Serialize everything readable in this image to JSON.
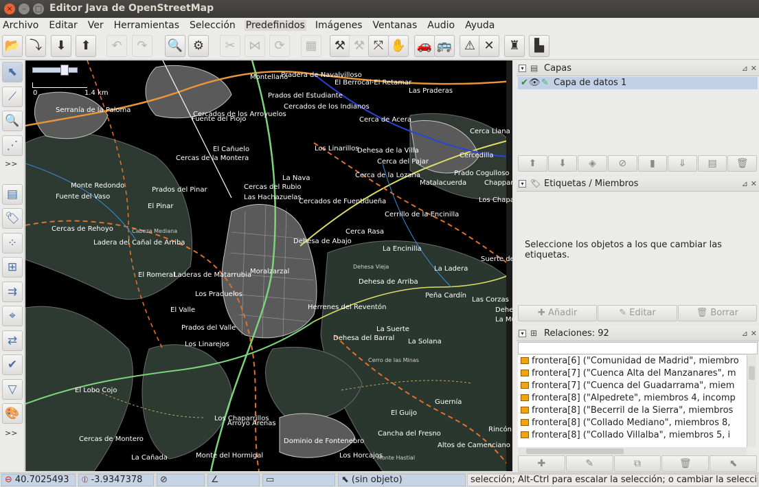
{
  "window": {
    "title": "Editor Java de OpenStreetMap"
  },
  "menu": [
    "Archivo",
    "Editar",
    "Ver",
    "Herramientas",
    "Selección",
    "Predefinidos",
    "Imágenes",
    "Ventanas",
    "Audio",
    "Ayuda"
  ],
  "map": {
    "scale_label": "1.4 km",
    "scale_zero": "0",
    "places": [
      {
        "t": "Montellano"
      },
      {
        "t": "Pradera de Navalvilloso"
      },
      {
        "t": "El Berrocal-El Retamar"
      },
      {
        "t": "Las Praderas"
      },
      {
        "t": "Prados del Estudiante"
      },
      {
        "t": "Cercados de los Indianos"
      },
      {
        "t": "Serranía de la Paloma"
      },
      {
        "t": "Cercados de los Arroyuelos"
      },
      {
        "t": "Fuente del Piojo"
      },
      {
        "t": "Cerca de Acera"
      },
      {
        "t": "Cerca Llana"
      },
      {
        "t": "El Cañuelo"
      },
      {
        "t": "Cercas de la Montera"
      },
      {
        "t": "Los Linarillos"
      },
      {
        "t": "Dehesa de la Villa"
      },
      {
        "t": "Cercedilla"
      },
      {
        "t": "Cerca del Pajar"
      },
      {
        "t": "La Nava"
      },
      {
        "t": "Cerca de la Lozana"
      },
      {
        "t": "Prado Cogulloso"
      },
      {
        "t": "Matalacuerda"
      },
      {
        "t": "Chapparal"
      },
      {
        "t": "Monte Redondo"
      },
      {
        "t": "Cercas del Rubio"
      },
      {
        "t": "Prados del Pinar"
      },
      {
        "t": "Fuente del Vaso"
      },
      {
        "t": "Las Hachazuelas"
      },
      {
        "t": "Los Chapa"
      },
      {
        "t": "El Pinar"
      },
      {
        "t": "Cercados de Fuentidueña"
      },
      {
        "t": "Cerrillo de la Encinilla"
      },
      {
        "t": "Cercas de Rehoyo"
      },
      {
        "t": "Cabeza Mediana"
      },
      {
        "t": "Cerca Rasa"
      },
      {
        "t": "Ladera del Cañal de Arriba"
      },
      {
        "t": "Dehesa de Abajo"
      },
      {
        "t": "La Encinilla"
      },
      {
        "t": "Suerte de"
      },
      {
        "t": "Dehesa Vieja"
      },
      {
        "t": "Moralzarzal"
      },
      {
        "t": "La Ladera"
      },
      {
        "t": "El Romeral"
      },
      {
        "t": "Laderas de Matarrubia"
      },
      {
        "t": "Dehesa de Arriba"
      },
      {
        "t": "Los Praduelos"
      },
      {
        "t": "Peña Cardín"
      },
      {
        "t": "Las Corzas"
      },
      {
        "t": "Dehe"
      },
      {
        "t": "Herrenes del Reventón"
      },
      {
        "t": "La Mue"
      },
      {
        "t": "El Valle"
      },
      {
        "t": "Prados del Valle"
      },
      {
        "t": "La Suerte"
      },
      {
        "t": "Dehesa del Barral"
      },
      {
        "t": "La Solana"
      },
      {
        "t": "Los Linarejos"
      },
      {
        "t": "Cerro de las Minas"
      },
      {
        "t": "El Lobo Cojo"
      },
      {
        "t": "Guernía"
      },
      {
        "t": "El Guijo"
      },
      {
        "t": "Los Chaparrillos"
      },
      {
        "t": "Arroyo Arenas"
      },
      {
        "t": "Dominio de Fontenebro"
      },
      {
        "t": "Cancha del Fresno"
      },
      {
        "t": "Rincón"
      },
      {
        "t": "Cercas de Montero"
      },
      {
        "t": "Altos de Camenciano"
      },
      {
        "t": "La Cañada"
      },
      {
        "t": "Monte del Hormigal"
      },
      {
        "t": "Los Horcajos"
      },
      {
        "t": "Monte Hastial"
      }
    ]
  },
  "layers_panel": {
    "title": "Capas",
    "layer_name": "Capa de datos 1"
  },
  "tags_panel": {
    "title": "Etiquetas / Miembros",
    "message": "Seleccione los objetos a los que cambiar las etiquetas.",
    "add": "Añadir",
    "edit": "Editar",
    "delete": "Borrar"
  },
  "relations_panel": {
    "title": "Relaciones: 92",
    "items": [
      "frontera[6] (\"Comunidad de Madrid\", miembro",
      "frontera[7] (\"Cuenca Alta del Manzanares\", m",
      "frontera[7] (\"Cuenca del Guadarrama\", miem",
      "frontera[8] (\"Alpedrete\", miembros 4, incomp",
      "frontera[8] (\"Becerril de la Sierra\", miembros",
      "frontera[8] (\"Collado Mediano\", miembros 8,",
      "frontera[8] (\"Collado Villalba\", miembros 5, i"
    ]
  },
  "status": {
    "lat": "40.7025493",
    "lon": "-3.9347378",
    "object": "(sin objeto)",
    "help": "selección; Alt-Ctrl para escalar la selección; o cambiar la selección"
  },
  "colors": {
    "map_bg": "#000000",
    "landuse": "#2e3a33",
    "urban": "#9a9a9a",
    "road_orange": "#e89438",
    "road_yellow": "#dddd66",
    "road_green": "#7cd47c",
    "border": "#e0712a",
    "highlight": "#c2d1e5"
  }
}
